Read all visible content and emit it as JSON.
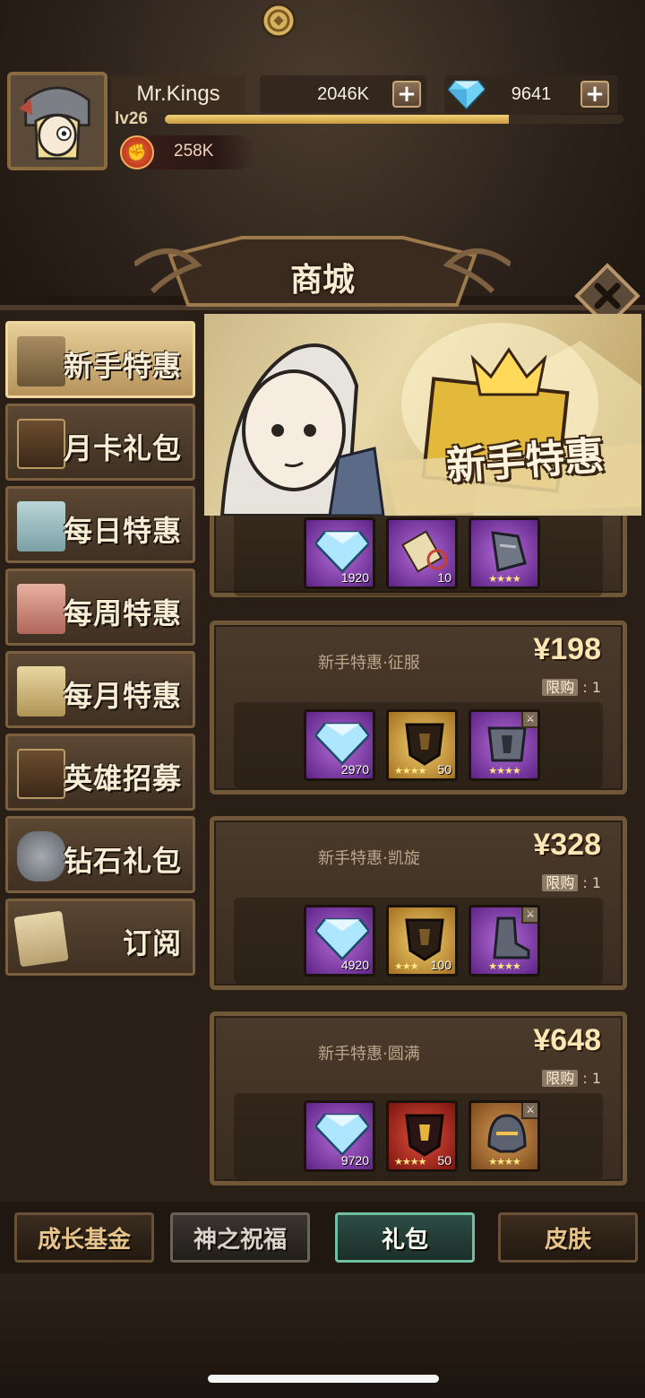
{
  "player": {
    "name": "Mr.Kings",
    "level": "lv26",
    "xp_progress": 0.75,
    "power": "258K"
  },
  "currencies": {
    "gold": "2046K",
    "diamonds": "9641"
  },
  "shop": {
    "title": "商城",
    "banner_text": "新手特惠"
  },
  "side_menu": [
    {
      "label": "新手特惠",
      "icon": "sale-tag-icon",
      "active": true
    },
    {
      "label": "月卡礼包",
      "icon": "card-icon"
    },
    {
      "label": "每日特惠",
      "icon": "gift-box-icon"
    },
    {
      "label": "每周特惠",
      "icon": "gift-box-icon"
    },
    {
      "label": "每月特惠",
      "icon": "gift-box-icon"
    },
    {
      "label": "英雄招募",
      "icon": "hero-card-icon"
    },
    {
      "label": "钻石礼包",
      "icon": "diamond-ore-icon"
    },
    {
      "label": "订阅",
      "icon": "scroll-icon"
    }
  ],
  "offers": [
    {
      "name": "",
      "price": "",
      "items": [
        {
          "type": "diamond",
          "qty": "1920"
        },
        {
          "type": "scroll",
          "qty": "10"
        },
        {
          "type": "gauntlet",
          "stars": "★★★★"
        }
      ]
    },
    {
      "name": "新手特惠·征服",
      "price": "¥198",
      "limit_label": "限购",
      "limit_value": "1",
      "items": [
        {
          "type": "diamond",
          "qty": "2970"
        },
        {
          "type": "armor-shard",
          "stars": "★★★★",
          "qty": "50"
        },
        {
          "type": "armor",
          "stars": "★★★★"
        }
      ]
    },
    {
      "name": "新手特惠·凯旋",
      "price": "¥328",
      "limit_label": "限购",
      "limit_value": "1",
      "items": [
        {
          "type": "diamond",
          "qty": "4920"
        },
        {
          "type": "armor-shard",
          "stars": "★★★",
          "qty": "100"
        },
        {
          "type": "boots",
          "stars": "★★★★"
        }
      ]
    },
    {
      "name": "新手特惠·圆满",
      "price": "¥648",
      "limit_label": "限购",
      "limit_value": "1",
      "items": [
        {
          "type": "diamond",
          "qty": "9720"
        },
        {
          "type": "armor-shard-red",
          "stars": "★★★★",
          "qty": "50"
        },
        {
          "type": "helmet",
          "stars": "★★★★"
        }
      ]
    }
  ],
  "bottom_tabs": [
    {
      "label": "成长基金"
    },
    {
      "label": "神之祝福"
    },
    {
      "label": "礼包",
      "active": true
    },
    {
      "label": "皮肤"
    }
  ],
  "colors": {
    "accent_gold": "#f0d79e",
    "active_tab": "#6fbfa0",
    "item_purple": "#5d2385"
  }
}
